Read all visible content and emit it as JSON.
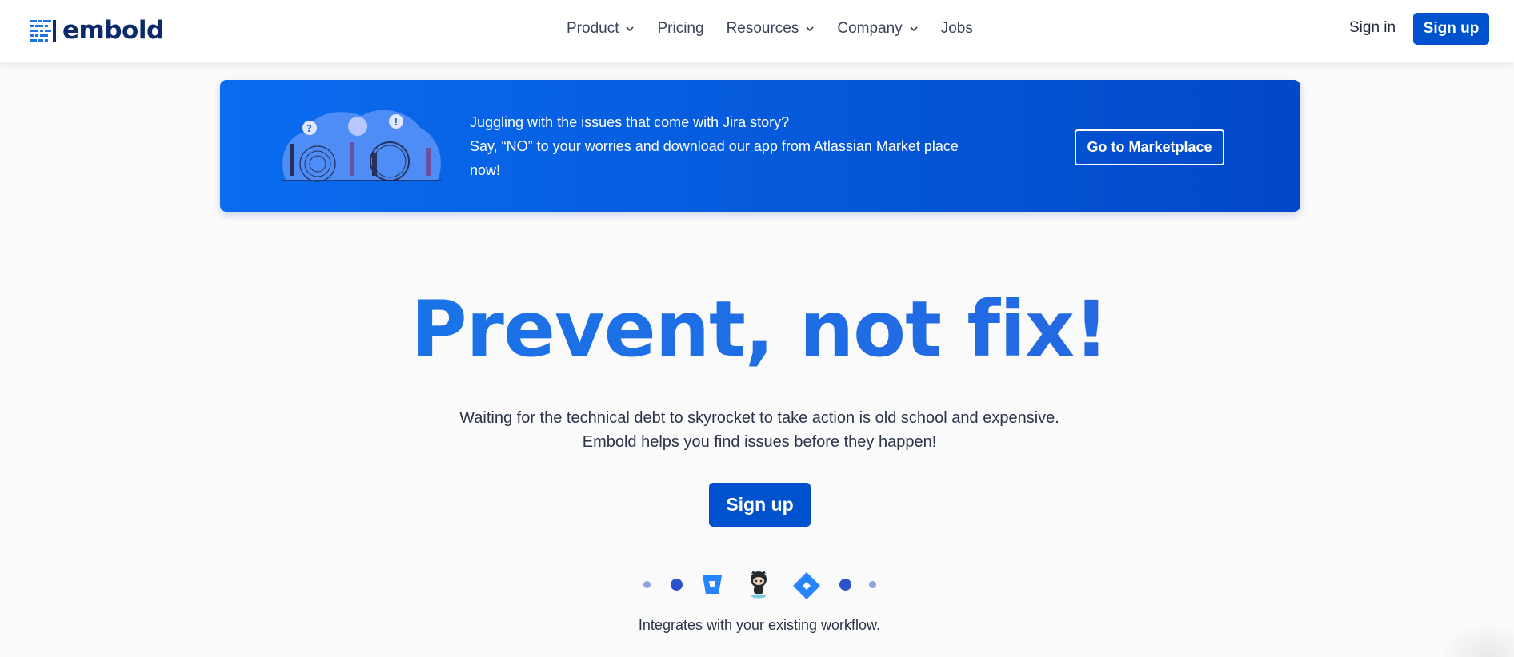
{
  "header": {
    "brand": "embold",
    "nav": [
      {
        "label": "Product",
        "has_dropdown": true
      },
      {
        "label": "Pricing",
        "has_dropdown": false
      },
      {
        "label": "Resources",
        "has_dropdown": true
      },
      {
        "label": "Company",
        "has_dropdown": true
      },
      {
        "label": "Jobs",
        "has_dropdown": false
      }
    ],
    "sign_in": "Sign in",
    "sign_up": "Sign up"
  },
  "banner": {
    "line1": "Juggling with the issues that come with Jira story?",
    "line2": "Say, “NO” to your worries and download our app from Atlassian Market place now!",
    "cta": "Go to Marketplace"
  },
  "hero": {
    "title": "Prevent, not fix!",
    "subtitle_line1": "Waiting for the technical debt to skyrocket to take action is old school and expensive.",
    "subtitle_line2": "Embold helps you find issues before they happen!",
    "cta": "Sign up"
  },
  "integrations": {
    "icons": [
      "bitbucket-icon",
      "github-octocat-icon",
      "jira-icon"
    ],
    "caption": "Integrates with your existing workflow."
  },
  "colors": {
    "primary": "#0052cc",
    "banner_start": "#0b6cf0",
    "banner_end": "#0248c9",
    "title_gradient_start": "#1479ea",
    "title_gradient_end": "#2a62df",
    "brand_text": "#0b2a6b"
  }
}
